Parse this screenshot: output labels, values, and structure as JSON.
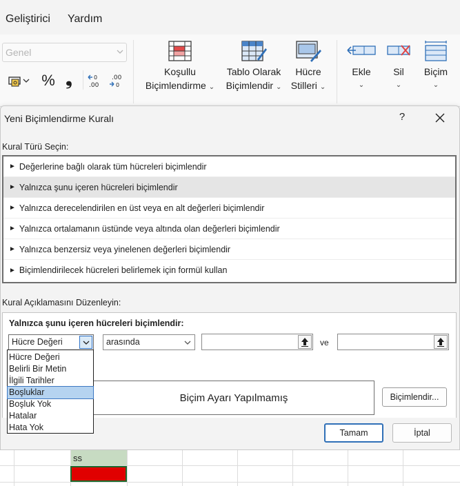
{
  "menu": {
    "developer": "Geliştirici",
    "help": "Yardım"
  },
  "ribbon": {
    "number_format_value": "Genel",
    "percent_symbol": "%",
    "comma_symbol": "❟",
    "increase_decimal": ".00",
    "decrease_decimal": ".00",
    "conditional_formatting": {
      "line1": "Koşullu",
      "line2": "Biçimlendirme"
    },
    "format_as_table": {
      "line1": "Tablo Olarak",
      "line2": "Biçimlendir"
    },
    "cell_styles": {
      "line1": "Hücre",
      "line2": "Stilleri"
    },
    "insert": "Ekle",
    "delete": "Sil",
    "format": "Biçim"
  },
  "dialog": {
    "title": "Yeni Biçimlendirme Kuralı",
    "help_symbol": "?",
    "select_rule_type_label": "Kural Türü Seçin:",
    "rule_types": [
      "Değerlerine bağlı olarak tüm hücreleri biçimlendir",
      "Yalnızca şunu içeren hücreleri biçimlendir",
      "Yalnızca derecelendirilen en üst veya en alt değerleri biçimlendir",
      "Yalnızca ortalamanın üstünde veya altında olan değerleri biçimlendir",
      "Yalnızca benzersiz veya yinelenen değerleri biçimlendir",
      "Biçimlendirilecek hücreleri belirlemek için formül kullan"
    ],
    "edit_rule_label": "Kural Açıklamasını Düzenleyin:",
    "format_only_heading": "Yalnızca şunu içeren hücreleri biçimlendir:",
    "cell_condition_value": "Hücre Değeri",
    "operator_value": "arasında",
    "and_label": "ve",
    "condition_options": [
      "Hücre Değeri",
      "Belirli Bir Metin",
      "İlgili Tarihler",
      "Boşluklar",
      "Boşluk Yok",
      "Hatalar",
      "Hata Yok"
    ],
    "highlighted_option_index": 3,
    "preview_text": "Biçim Ayarı Yapılmamış",
    "format_button": "Biçimlendir...",
    "ok_button": "Tamam",
    "cancel_button": "İptal"
  },
  "sheet": {
    "cell_text": "ss",
    "highlight_fill": "#e00000"
  }
}
